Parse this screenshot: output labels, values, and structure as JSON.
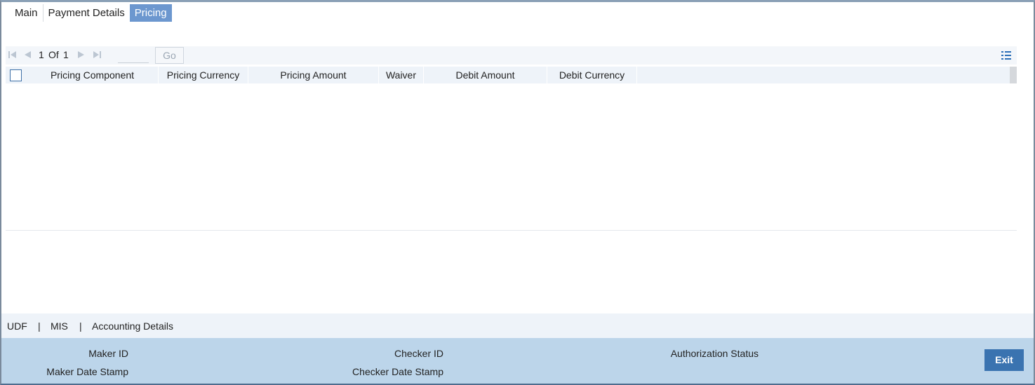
{
  "tabs": [
    {
      "label": "Main"
    },
    {
      "label": "Payment Details"
    },
    {
      "label": "Pricing"
    }
  ],
  "active_tab": "Pricing",
  "pagination": {
    "current": "1",
    "of_label": "Of",
    "total": "1",
    "go_label": "Go",
    "page_input_value": ""
  },
  "grid": {
    "columns": [
      {
        "label": "Pricing Component"
      },
      {
        "label": "Pricing Currency"
      },
      {
        "label": "Pricing Amount"
      },
      {
        "label": "Waiver"
      },
      {
        "label": "Debit Amount"
      },
      {
        "label": "Debit Currency"
      }
    ],
    "rows": []
  },
  "sublinks": {
    "udf": "UDF",
    "sep1": "|",
    "mis": "MIS",
    "sep2": "|",
    "accounting": "Accounting Details"
  },
  "audit": {
    "maker_id": "Maker ID",
    "maker_date": "Maker Date Stamp",
    "checker_id": "Checker ID",
    "checker_date": "Checker Date Stamp",
    "auth_status": "Authorization Status",
    "exit_label": "Exit"
  },
  "icons": {
    "first": "first-page-icon",
    "prev": "prev-page-icon",
    "next": "next-page-icon",
    "last": "last-page-icon",
    "settings": "column-settings-icon"
  },
  "colors": {
    "active_tab": "#6c97cf",
    "exit_button": "#3a73b0",
    "audit_strip": "#bcd5ea",
    "grid_header": "#eef3f9"
  }
}
